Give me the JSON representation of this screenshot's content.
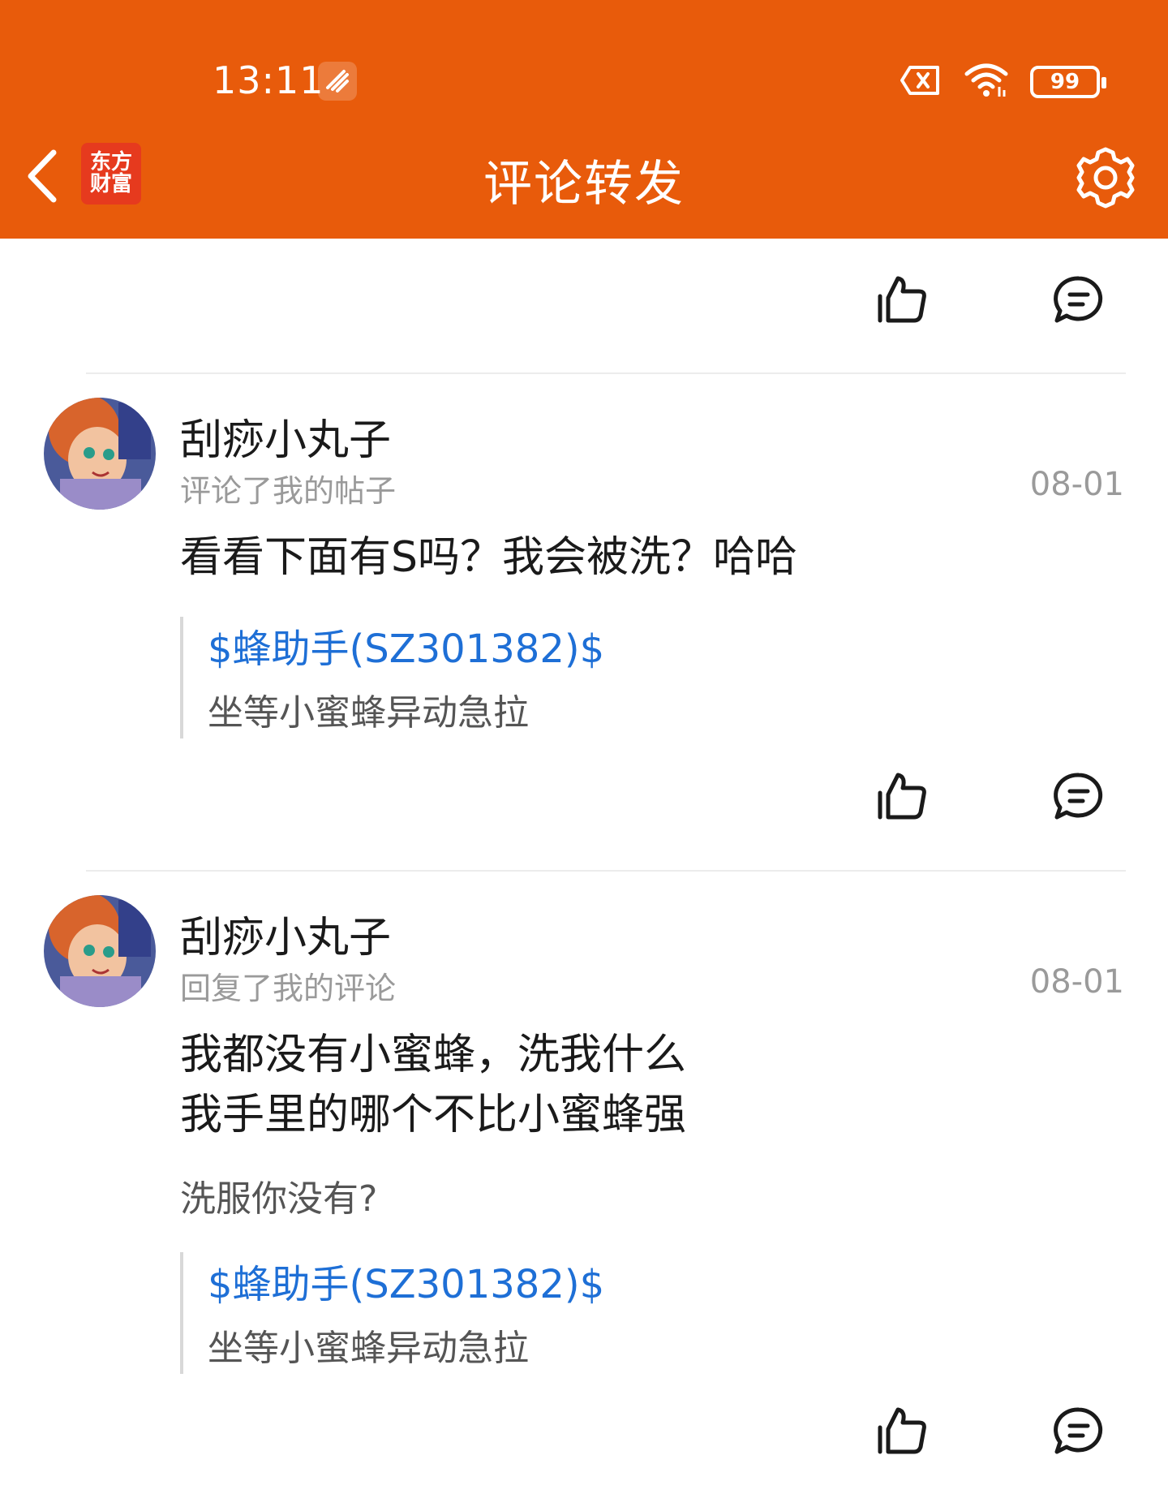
{
  "status_bar": {
    "time": "13:11",
    "battery": "99",
    "icons": [
      "app-notification-icon",
      "sim-card-error-icon",
      "wifi-icon",
      "battery-icon"
    ]
  },
  "header": {
    "title": "评论转发",
    "brand_line1": "东方",
    "brand_line2": "财富",
    "back_icon": "chevron-left-icon",
    "settings_icon": "gear-icon"
  },
  "feed": {
    "items": [
      {
        "username": "刮痧小丸子",
        "action": "评论了我的帖子",
        "date": "08-01",
        "body_line1": "看看下面有S吗？我会被洗？哈哈",
        "body_line2": "",
        "extra": "",
        "quote_link": "$蜂助手(SZ301382)$",
        "quote_text": "坐等小蜜蜂异动急拉"
      },
      {
        "username": "刮痧小丸子",
        "action": "回复了我的评论",
        "date": "08-01",
        "body_line1": "我都没有小蜜蜂，洗我什么",
        "body_line2": "我手里的哪个不比小蜜蜂强",
        "extra": "洗服你没有?",
        "quote_link": "$蜂助手(SZ301382)$",
        "quote_text": "坐等小蜜蜂异动急拉"
      }
    ]
  },
  "colors": {
    "header_bg": "#E85B0B",
    "link": "#1E6FD6",
    "muted": "#9a9a9a"
  }
}
